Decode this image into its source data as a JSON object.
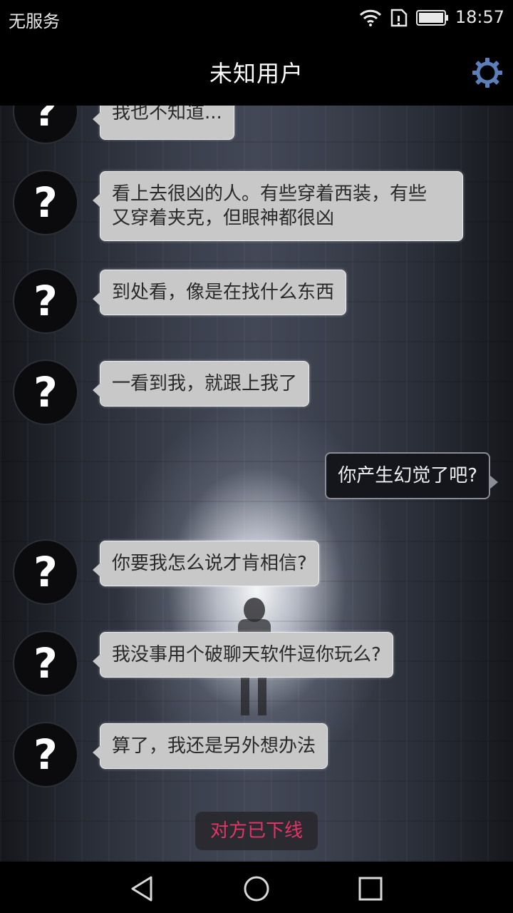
{
  "status_bar": {
    "carrier": "无服务",
    "time": "18:57",
    "icons": [
      "wifi-icon",
      "sim-icon",
      "battery-icon"
    ]
  },
  "title_bar": {
    "title": "未知用户",
    "settings_icon": "gear-icon"
  },
  "messages": [
    {
      "side": "in",
      "text": "我也不知道..."
    },
    {
      "side": "in",
      "text": "看上去很凶的人。有些穿着西装，有些",
      "text2": "又穿着夹克，但眼神都很凶"
    },
    {
      "side": "in",
      "text": "到处看，像是在找什么东西"
    },
    {
      "side": "in",
      "text": "一看到我，就跟上我了"
    },
    {
      "side": "out",
      "text": "你产生幻觉了吧?"
    },
    {
      "side": "in",
      "text": "你要我怎么说才肯相信?"
    },
    {
      "side": "in",
      "text": "我没事用个破聊天软件逗你玩么?"
    },
    {
      "side": "in",
      "text": "算了，我还是另外想办法"
    }
  ],
  "avatar_glyph": "?",
  "offline_notice": "对方已下线",
  "nav_bar": {
    "buttons": [
      "back-icon",
      "home-icon",
      "recents-icon"
    ]
  },
  "colors": {
    "incoming_bubble": "#c8c8c8",
    "outgoing_bubble": "#14161c",
    "offline_text": "#e43466"
  }
}
